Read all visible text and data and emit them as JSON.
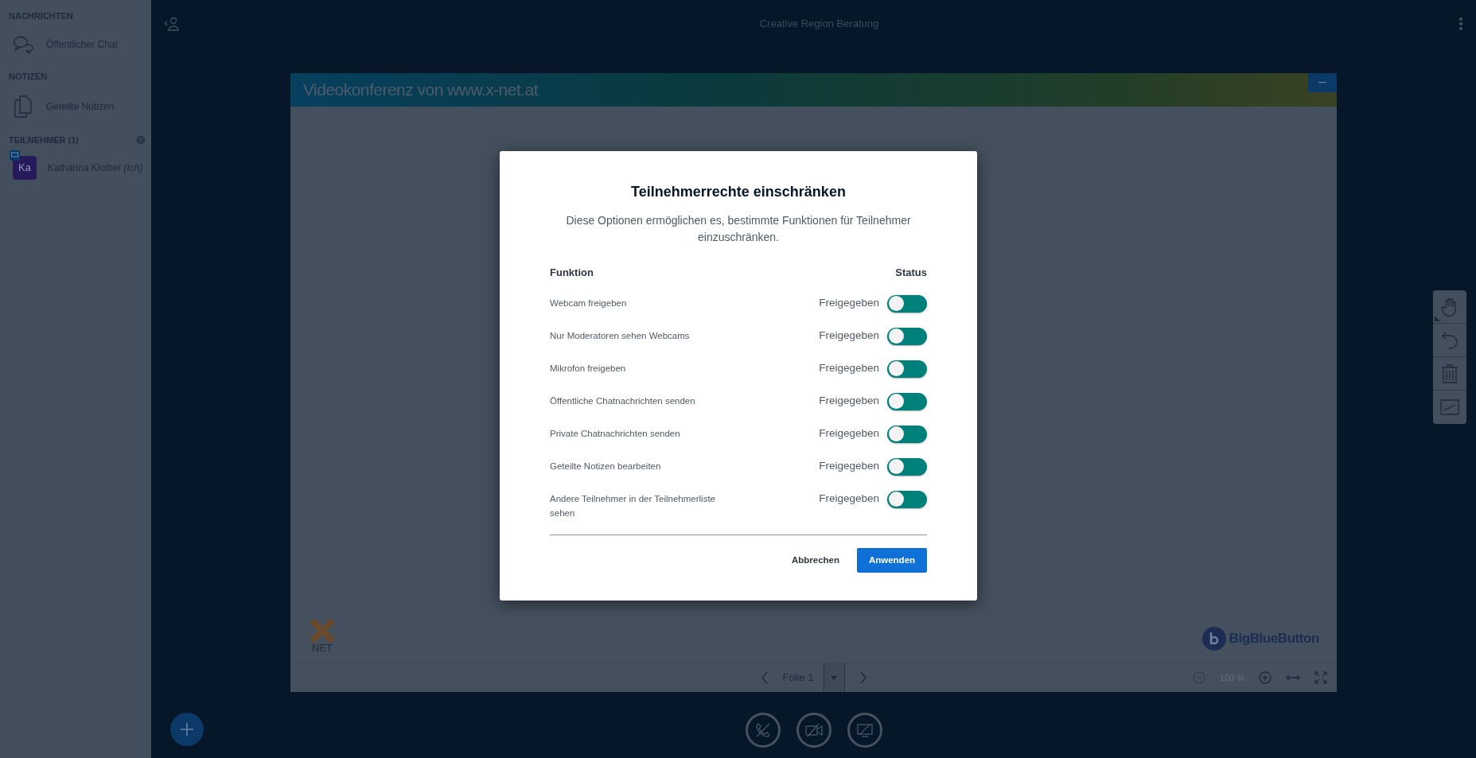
{
  "sidebar": {
    "sections": [
      {
        "title": "NACHRICHTEN",
        "items": [
          {
            "kind": "chat",
            "label": "Öffentlicher Chat"
          }
        ]
      },
      {
        "title": "NOTIZEN",
        "items": [
          {
            "kind": "notes",
            "label": "Geteilte Notizen"
          }
        ]
      },
      {
        "title": "TEILNEHMER (1)",
        "settings": true,
        "items": [
          {
            "kind": "user",
            "initials": "Ka",
            "name": "Katharina Kloiber",
            "suffix": "(Ich)"
          }
        ]
      }
    ]
  },
  "header": {
    "title": "Creative Region Beratung"
  },
  "slide": {
    "banner": "Videokonferenz von www.x-net.at",
    "left_logo": "NET",
    "right_logo": "BigBlueButton"
  },
  "slide_controls": {
    "page": "Folie 1",
    "zoom": "100 %"
  },
  "dialog": {
    "title": "Teilnehmerrechte einschränken",
    "description": "Diese Optionen ermöglichen es, bestimmte Funktionen für Teilnehmer einzuschränken.",
    "col_function": "Funktion",
    "col_status": "Status",
    "rows": [
      {
        "label": "Webcam freigeben",
        "status": "Freigegeben",
        "locked": false
      },
      {
        "label": "Nur Moderatoren sehen Webcams",
        "status": "Freigegeben",
        "locked": false
      },
      {
        "label": "Mikrofon freigeben",
        "status": "Freigegeben",
        "locked": false
      },
      {
        "label": "Öffentliche Chatnachrichten senden",
        "status": "Freigegeben",
        "locked": false
      },
      {
        "label": "Private Chatnachrichten senden",
        "status": "Freigegeben",
        "locked": false
      },
      {
        "label": "Geteilte Notizen bearbeiten",
        "status": "Freigegeben",
        "locked": false
      },
      {
        "label": "Andere Teilnehmer in der Teilnehmerliste sehen",
        "status": "Freigegeben",
        "locked": false
      }
    ],
    "cancel": "Abbrechen",
    "apply": "Anwenden"
  }
}
